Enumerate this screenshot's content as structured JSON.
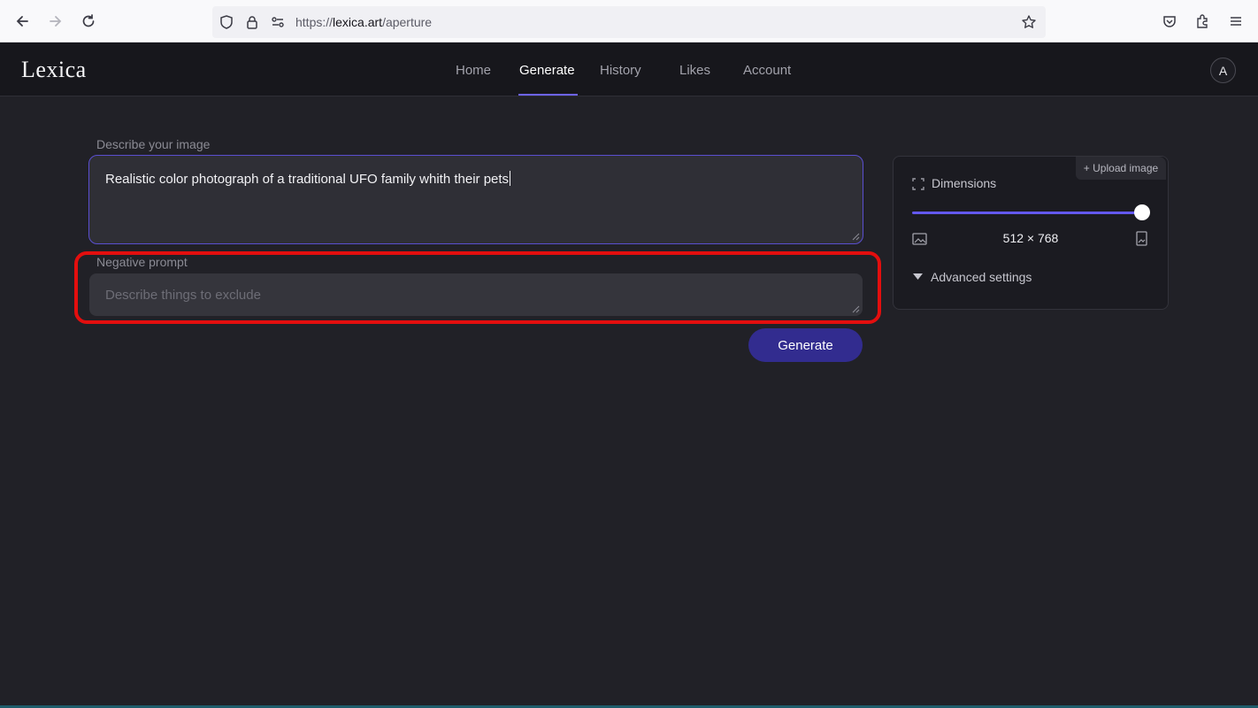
{
  "browser": {
    "url_scheme": "https://",
    "url_host": "lexica.art",
    "url_path": "/aperture"
  },
  "header": {
    "logo": "Lexica",
    "nav": [
      {
        "label": "Home"
      },
      {
        "label": "Generate"
      },
      {
        "label": "History"
      },
      {
        "label": "Likes"
      },
      {
        "label": "Account"
      }
    ],
    "active_nav": "Generate",
    "avatar_initial": "A"
  },
  "form": {
    "prompt_label": "Describe your image",
    "prompt_value": "Realistic color photograph of a traditional UFO family whith their pets",
    "negative_label": "Negative prompt",
    "negative_placeholder": "Describe things to exclude",
    "generate_label": "Generate"
  },
  "settings": {
    "upload_label": "+ Upload image",
    "dimensions_label": "Dimensions",
    "dimensions_value": "512 × 768",
    "slider_level": 1.0,
    "advanced_label": "Advanced settings"
  },
  "colors": {
    "accent": "#6d63f2",
    "button": "#322c8f",
    "highlight": "#e30e0e",
    "background": "#212127"
  },
  "icons": [
    "back-arrow-icon",
    "forward-arrow-icon",
    "reload-icon",
    "shield-icon",
    "lock-icon",
    "permissions-icon",
    "star-icon",
    "pocket-icon",
    "extensions-icon",
    "menu-icon",
    "expand-icon",
    "landscape-image-icon",
    "portrait-image-icon",
    "caret-down-icon"
  ]
}
